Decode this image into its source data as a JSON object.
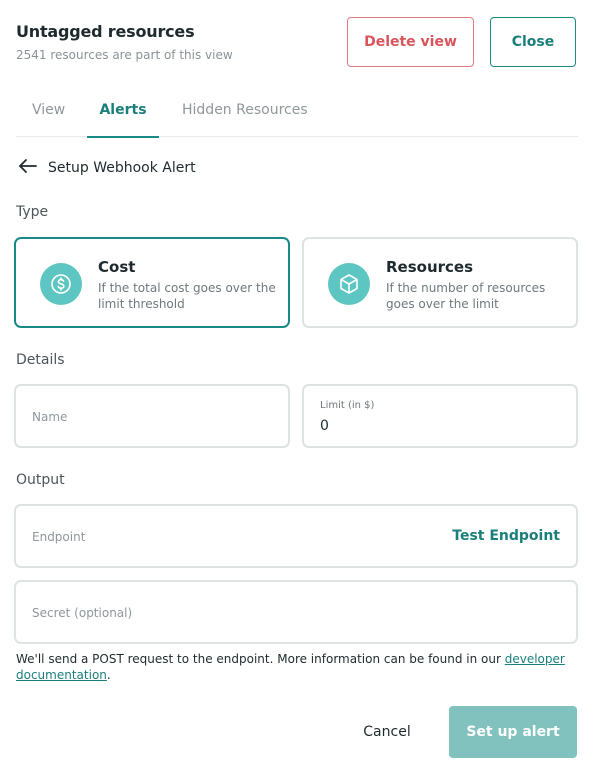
{
  "header": {
    "title": "Untagged resources",
    "subtitle": "2541 resources are part of this view",
    "delete_label": "Delete view",
    "close_label": "Close"
  },
  "tabs": [
    {
      "label": "View",
      "active": false
    },
    {
      "label": "Alerts",
      "active": true
    },
    {
      "label": "Hidden Resources",
      "active": false
    }
  ],
  "back": {
    "label": "Setup Webhook Alert",
    "icon": "arrow-left-icon"
  },
  "type_section": {
    "label": "Type",
    "options": [
      {
        "title": "Cost",
        "description": "If the total cost goes over the limit threshold",
        "icon": "dollar-icon",
        "selected": true
      },
      {
        "title": "Resources",
        "description": "If the number of resources goes over the limit",
        "icon": "cube-icon",
        "selected": false
      }
    ]
  },
  "details_section": {
    "label": "Details",
    "name_placeholder": "Name",
    "name_value": "",
    "limit_label": "Limit (in $)",
    "limit_value": "0"
  },
  "output_section": {
    "label": "Output",
    "endpoint_placeholder": "Endpoint",
    "endpoint_value": "",
    "test_endpoint_label": "Test Endpoint",
    "secret_placeholder": "Secret (optional)",
    "secret_value": ""
  },
  "note": {
    "text": "We'll send a POST request to the endpoint. More information can be found in our ",
    "link_text": "developer documentation",
    "suffix": "."
  },
  "footer": {
    "cancel_label": "Cancel",
    "submit_label": "Set up alert"
  },
  "colors": {
    "accent": "#1a8a86",
    "danger": "#d9545b",
    "icon_bg": "#5ec6c2",
    "submit_disabled": "#82c2be"
  }
}
